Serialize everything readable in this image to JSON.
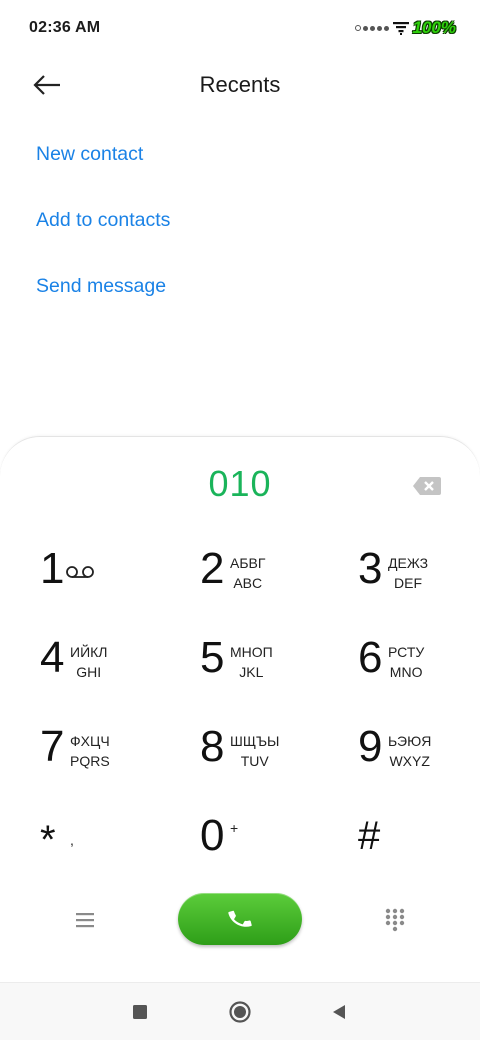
{
  "status_bar": {
    "time": "02:36 AM",
    "battery": "100%"
  },
  "header": {
    "title": "Recents",
    "back_icon": "arrow-left-icon"
  },
  "actions": [
    {
      "label": "New contact"
    },
    {
      "label": "Add to contacts"
    },
    {
      "label": "Send message"
    }
  ],
  "dialer": {
    "number": "010",
    "keys": [
      {
        "digit": "1",
        "sub1": "",
        "sub2": "",
        "icon": "voicemail-icon"
      },
      {
        "digit": "2",
        "sub1": "АБВГ",
        "sub2": "ABC"
      },
      {
        "digit": "3",
        "sub1": "ДЕЖЗ",
        "sub2": "DEF"
      },
      {
        "digit": "4",
        "sub1": "ИЙКЛ",
        "sub2": "GHI"
      },
      {
        "digit": "5",
        "sub1": "МНОП",
        "sub2": "JKL"
      },
      {
        "digit": "6",
        "sub1": "РСТУ",
        "sub2": "MNO"
      },
      {
        "digit": "7",
        "sub1": "ФХЦЧ",
        "sub2": "PQRS"
      },
      {
        "digit": "8",
        "sub1": "ШЩЪЫ",
        "sub2": "TUV"
      },
      {
        "digit": "9",
        "sub1": "ЬЭЮЯ",
        "sub2": "WXYZ"
      },
      {
        "digit": "*",
        "sub1": ",",
        "sub2": ""
      },
      {
        "digit": "0",
        "sub1": "+",
        "sub2": ""
      },
      {
        "digit": "#",
        "sub1": "",
        "sub2": ""
      }
    ]
  },
  "colors": {
    "accent_link": "#1a82e6",
    "dialed_number": "#1ab45a",
    "call_button": "#3fb525"
  }
}
